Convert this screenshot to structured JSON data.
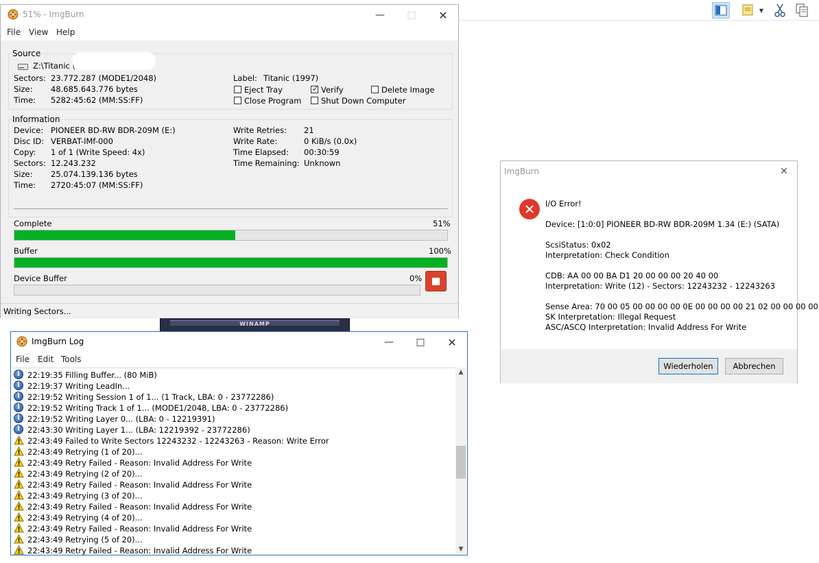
{
  "background": {
    "toolbar_icons": [
      "panel-layout-icon",
      "note-icon",
      "cut-icon",
      "copy-icon"
    ]
  },
  "main_window": {
    "title": "51% - ImgBurn",
    "menu": [
      "File",
      "View",
      "Help"
    ],
    "source": {
      "group_title": "Source",
      "path": "Z:\\Titanic (",
      "sectors_label": "Sectors:",
      "sectors": "23.772.287 (MODE1/2048)",
      "size_label": "Size:",
      "size": "48.685.643.776 bytes",
      "time_label": "Time:",
      "time": "5282:45:62 (MM:SS:FF)",
      "label_label": "Label:",
      "label": "Titanic (1997)",
      "options": {
        "eject_tray": {
          "label": "Eject Tray",
          "checked": false
        },
        "verify": {
          "label": "Verify",
          "checked": true
        },
        "delete_image": {
          "label": "Delete Image",
          "checked": false
        },
        "close_program": {
          "label": "Close Program",
          "checked": false
        },
        "shut_down": {
          "label": "Shut Down Computer",
          "checked": false
        }
      }
    },
    "information": {
      "group_title": "Information",
      "device_label": "Device:",
      "device": "PIONEER BD-RW  BDR-209M (E:)",
      "disc_id_label": "Disc ID:",
      "disc_id": "VERBAT-IMf-000",
      "copy_label": "Copy:",
      "copy": "1 of 1 (Write Speed: 4x)",
      "sectors_label": "Sectors:",
      "sectors": "12.243.232",
      "size_label": "Size:",
      "size": "25.074.139.136 bytes",
      "time_label": "Time:",
      "time": "2720:45:07 (MM:SS:FF)",
      "write_retries_label": "Write Retries:",
      "write_retries": "21",
      "write_rate_label": "Write Rate:",
      "write_rate": "0 KiB/s (0.0x)",
      "time_elapsed_label": "Time Elapsed:",
      "time_elapsed": "00:30:59",
      "time_remaining_label": "Time Remaining:",
      "time_remaining": "Unknown"
    },
    "progress": {
      "complete_label": "Complete",
      "complete_text": "51%",
      "complete": 0.51,
      "buffer_label": "Buffer",
      "buffer_text": "100%",
      "buffer": 1.0,
      "device_buffer_label": "Device Buffer",
      "device_buffer_text": "0%",
      "device_buffer": 0.0
    },
    "status": "Writing Sectors..."
  },
  "winamp": {
    "title": "WINAMP"
  },
  "log_window": {
    "title": "ImgBurn Log",
    "menu": [
      "File",
      "Edit",
      "Tools"
    ],
    "entries": [
      {
        "icon": "info",
        "text": "22:19:35 Filling Buffer... (80 MiB)"
      },
      {
        "icon": "info",
        "text": "22:19:37 Writing LeadIn..."
      },
      {
        "icon": "info",
        "text": "22:19:52 Writing Session 1 of 1... (1 Track, LBA: 0 - 23772286)"
      },
      {
        "icon": "info",
        "text": "22:19:52 Writing Track 1 of 1... (MODE1/2048, LBA: 0 - 23772286)"
      },
      {
        "icon": "info",
        "text": "22:19:52 Writing Layer 0... (LBA: 0 - 12219391)"
      },
      {
        "icon": "info",
        "text": "22:43:30 Writing Layer 1... (LBA: 12219392 - 23772286)"
      },
      {
        "icon": "warn",
        "text": "22:43:49 Failed to Write Sectors 12243232 - 12243263 - Reason: Write Error"
      },
      {
        "icon": "warn",
        "text": "22:43:49 Retrying (1 of 20)..."
      },
      {
        "icon": "warn",
        "text": "22:43:49 Retry Failed - Reason: Invalid Address For Write"
      },
      {
        "icon": "warn",
        "text": "22:43:49 Retrying (2 of 20)..."
      },
      {
        "icon": "warn",
        "text": "22:43:49 Retry Failed - Reason: Invalid Address For Write"
      },
      {
        "icon": "warn",
        "text": "22:43:49 Retrying (3 of 20)..."
      },
      {
        "icon": "warn",
        "text": "22:43:49 Retry Failed - Reason: Invalid Address For Write"
      },
      {
        "icon": "warn",
        "text": "22:43:49 Retrying (4 of 20)..."
      },
      {
        "icon": "warn",
        "text": "22:43:49 Retry Failed - Reason: Invalid Address For Write"
      },
      {
        "icon": "warn",
        "text": "22:43:49 Retrying (5 of 20)..."
      },
      {
        "icon": "warn",
        "text": "22:43:49 Retry Failed - Reason: Invalid Address For Write"
      }
    ]
  },
  "error_dialog": {
    "title": "ImgBurn",
    "heading": "I/O Error!",
    "device": "Device: [1:0:0] PIONEER BD-RW   BDR-209M 1.34 (E:) (SATA)",
    "scsi_status": "ScsiStatus: 0x02",
    "interpretation1": "Interpretation: Check Condition",
    "cdb": "CDB: AA 00 00 BA D1 20 00 00 00 20 40 00",
    "interpretation2": "Interpretation: Write (12) - Sectors: 12243232 - 12243263",
    "sense_area": "Sense Area: 70 00 05 00 00 00 00 0E 00 00 00 00 21 02 00 00 00 00",
    "sk_interpretation": "SK Interpretation: Illegal Request",
    "ascq_interpretation": "ASC/ASCQ Interpretation: Invalid Address For Write",
    "retry_button": "Wiederholen",
    "cancel_button": "Abbrechen"
  },
  "colors": {
    "progress_green": "#06b025",
    "stop_red": "#d9432c",
    "error_red": "#e0382b",
    "log_border": "#2d6fb3"
  }
}
